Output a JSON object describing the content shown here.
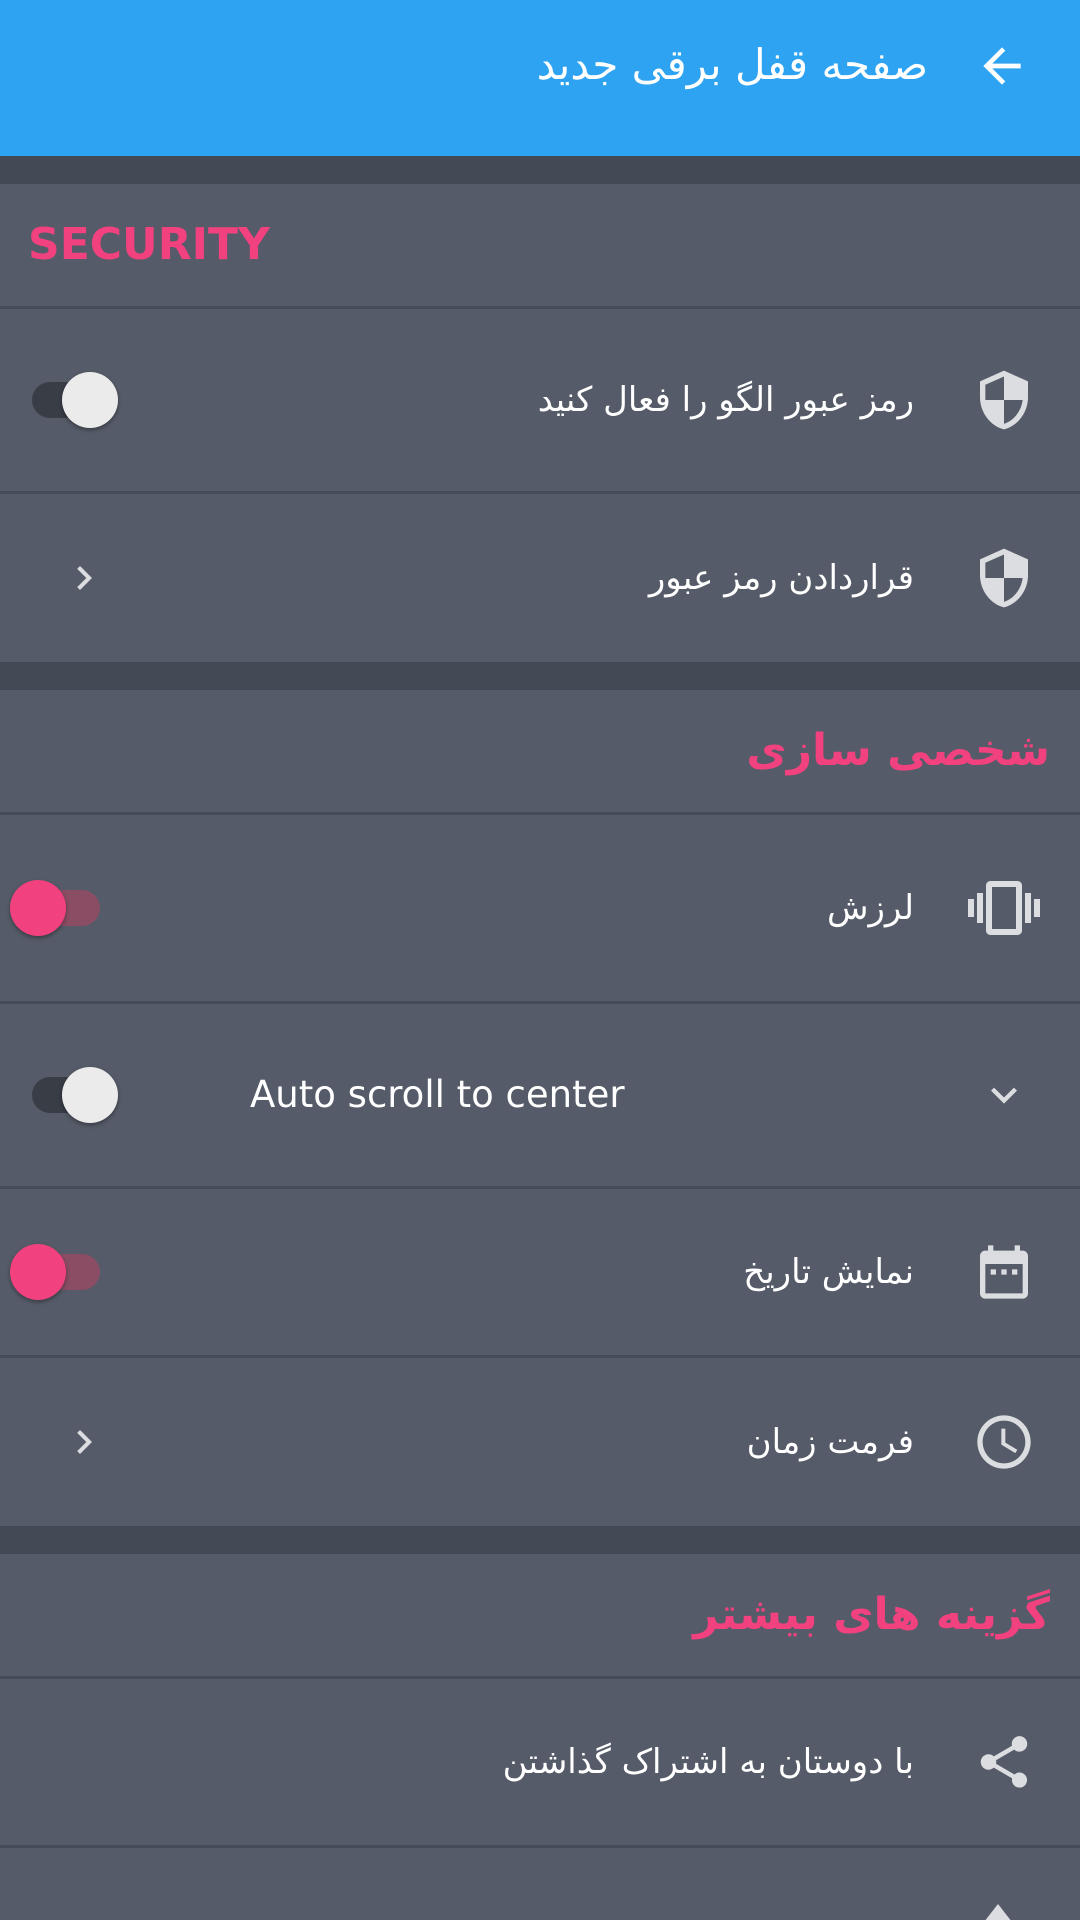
{
  "appbar": {
    "title": "صفحه قفل برقی جدید",
    "back_icon": "arrow-back-icon",
    "background": "#2ea3f2"
  },
  "accent_color": "#f2417f",
  "sections": [
    {
      "header": "SECURITY",
      "items": [
        {
          "label": "رمز عبور الگو را فعال کنید",
          "icon": "shield-icon",
          "control": "toggle",
          "checked": false
        },
        {
          "label": "قراردادن رمز عبور",
          "icon": "shield-icon",
          "control": "chevron"
        }
      ]
    },
    {
      "header": "شخصی سازی",
      "items": [
        {
          "label": "لرزش",
          "icon": "vibration-icon",
          "control": "toggle",
          "checked": false
        },
        {
          "label": "Auto scroll to center",
          "icon": "chevron-down-icon",
          "control": "toggle",
          "checked": false
        },
        {
          "label": "نمایش تاریخ",
          "icon": "calendar-icon",
          "control": "toggle",
          "checked": false
        },
        {
          "label": "فرمت زمان",
          "icon": "clock-icon",
          "control": "chevron"
        }
      ]
    },
    {
      "header": "گزینه های بیشتر",
      "items": [
        {
          "label": "با دوستان به اشتراک گذاشتن",
          "icon": "share-icon",
          "control": "none"
        }
      ]
    }
  ]
}
